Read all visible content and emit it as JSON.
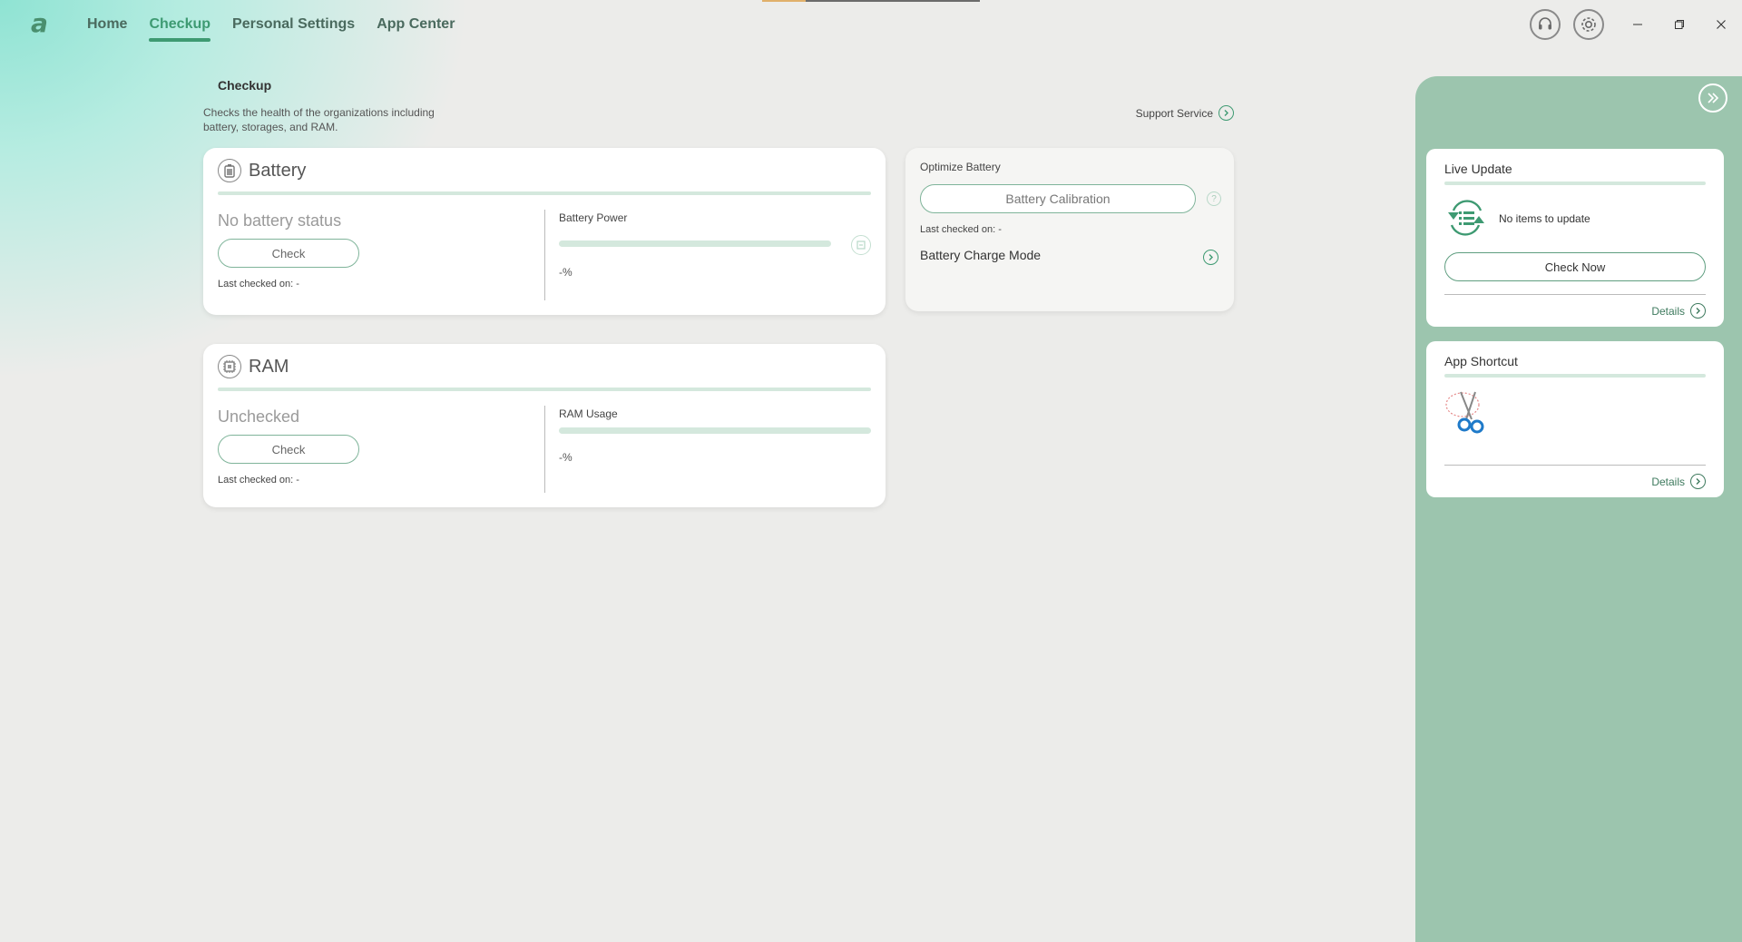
{
  "header": {
    "logo": "a",
    "nav": [
      {
        "label": "Home"
      },
      {
        "label": "Checkup",
        "active": true
      },
      {
        "label": "Personal Settings"
      },
      {
        "label": "App Center"
      }
    ],
    "icons": [
      "headset-icon",
      "gear-icon"
    ],
    "window_controls": [
      "minimize",
      "restore",
      "close"
    ]
  },
  "page": {
    "title": "Checkup",
    "description": "Checks the health of the organizations including battery, storages, and RAM.",
    "support_label": "Support Service"
  },
  "battery": {
    "title": "Battery",
    "status": "No battery status",
    "check_label": "Check",
    "last_checked": "Last checked on: -",
    "metric_label": "Battery Power",
    "metric_value": "-%",
    "metric_fill": 0
  },
  "optimize": {
    "label": "Optimize Battery",
    "calibration_label": "Battery Calibration",
    "help": "?",
    "last_checked": "Last checked on: -",
    "charge_mode_label": "Battery Charge Mode"
  },
  "ram": {
    "title": "RAM",
    "status": "Unchecked",
    "check_label": "Check",
    "last_checked": "Last checked on: -",
    "metric_label": "RAM Usage",
    "metric_value": "-%",
    "metric_fill": 0
  },
  "side": {
    "live_update": {
      "title": "Live Update",
      "status": "No items to update",
      "button": "Check Now",
      "details": "Details"
    },
    "app_shortcut": {
      "title": "App Shortcut",
      "items": [
        "snipping-tool-icon"
      ],
      "details": "Details"
    }
  },
  "colors": {
    "accent": "#3e9a72",
    "panel": "#9cc5ae",
    "background": "#ececea"
  }
}
